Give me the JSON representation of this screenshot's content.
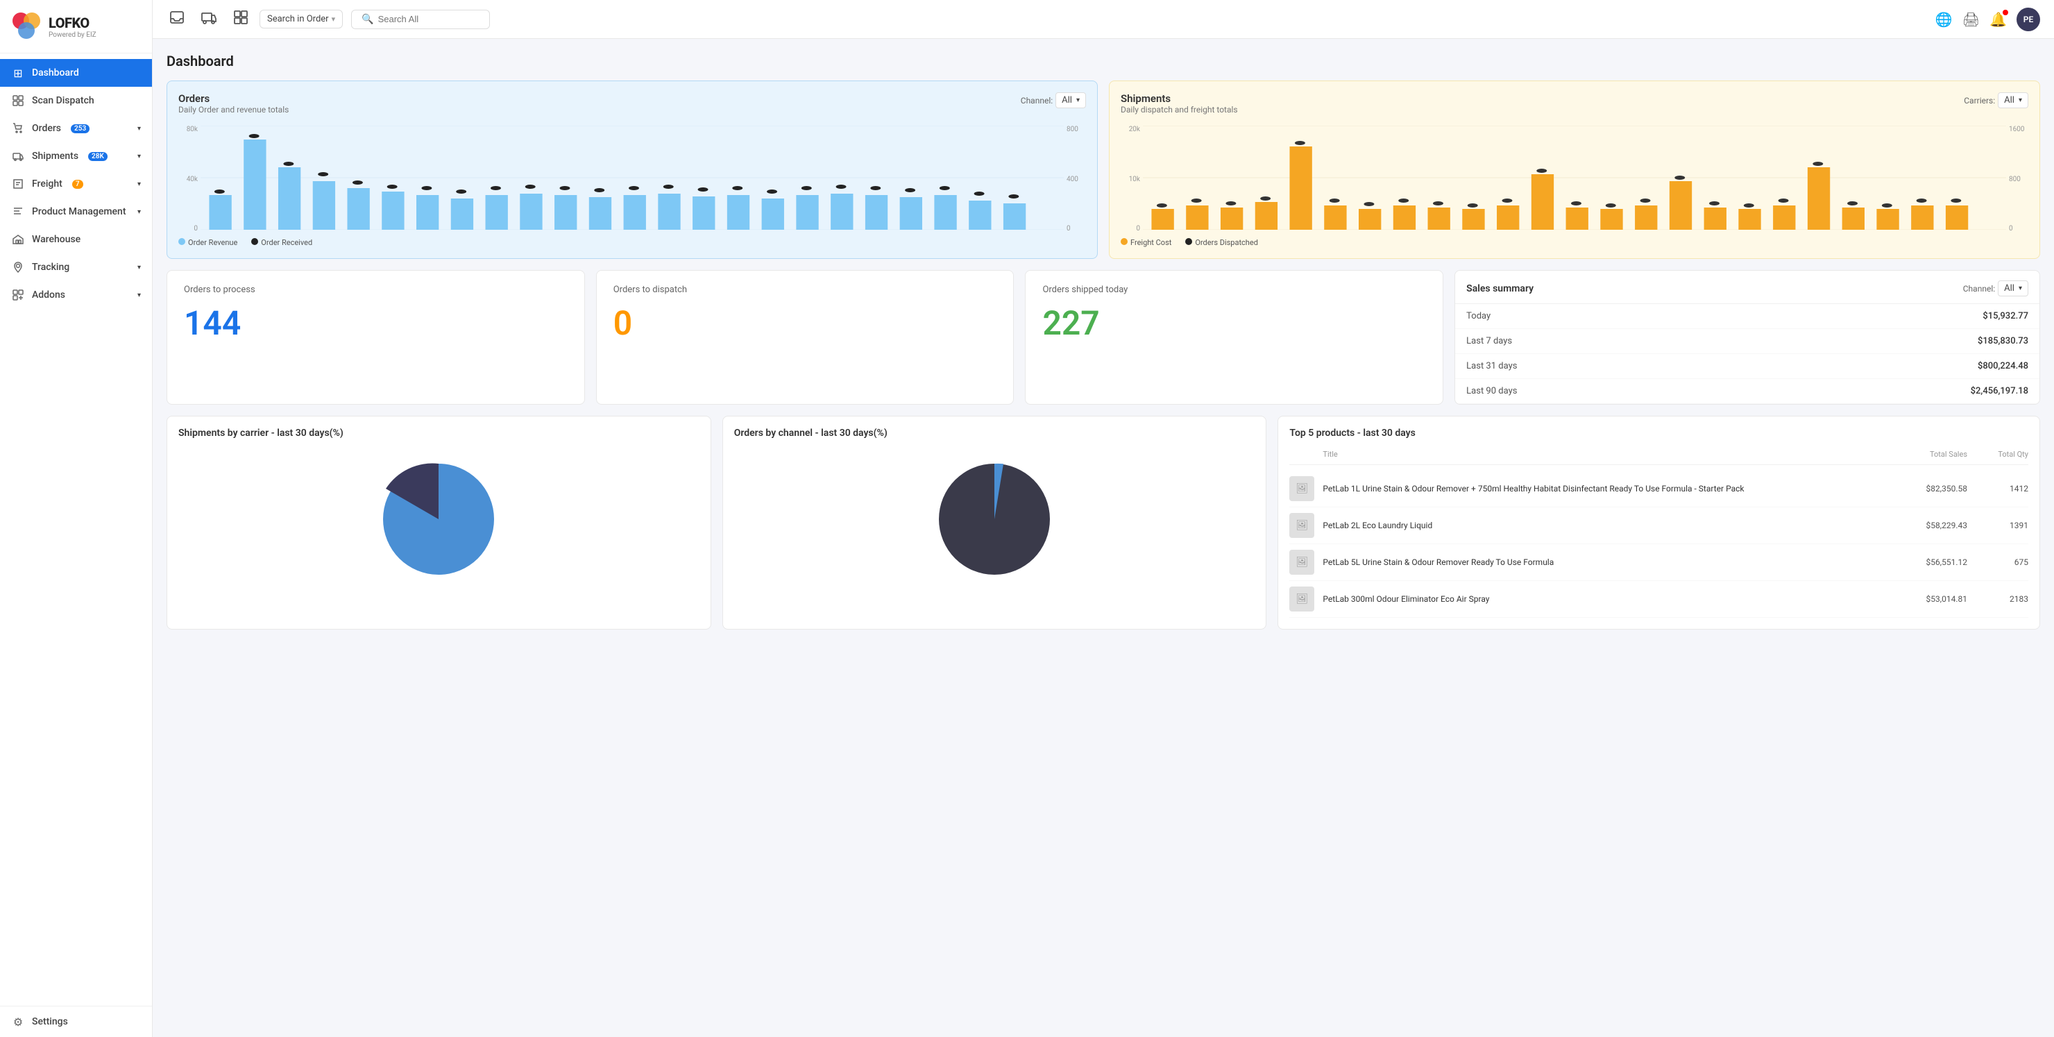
{
  "logo": {
    "main": "LOFKO",
    "sub": "Powered by EIZ"
  },
  "sidebar": {
    "items": [
      {
        "id": "dashboard",
        "label": "Dashboard",
        "icon": "⊞",
        "active": true
      },
      {
        "id": "scan-dispatch",
        "label": "Scan Dispatch",
        "icon": "📦"
      },
      {
        "id": "orders",
        "label": "Orders",
        "icon": "🛒",
        "badge": "253",
        "hasChildren": true
      },
      {
        "id": "shipments",
        "label": "Shipments",
        "icon": "🚚",
        "badge": "28K",
        "hasChildren": true
      },
      {
        "id": "freight",
        "label": "Freight",
        "icon": "📄",
        "badge": "7",
        "hasChildren": true
      },
      {
        "id": "product-management",
        "label": "Product Management",
        "icon": "📋",
        "hasChildren": true
      },
      {
        "id": "warehouse",
        "label": "Warehouse",
        "icon": "🏭"
      },
      {
        "id": "tracking",
        "label": "Tracking",
        "icon": "📍",
        "hasChildren": true
      },
      {
        "id": "addons",
        "label": "Addons",
        "icon": "🔌",
        "hasChildren": true
      }
    ],
    "settings": {
      "label": "Settings",
      "icon": "⚙"
    }
  },
  "topbar": {
    "search_order_placeholder": "Search in Order",
    "search_all_placeholder": "Search All"
  },
  "dashboard": {
    "title": "Dashboard",
    "orders_chart": {
      "title": "Orders",
      "subtitle": "Daily Order and revenue totals",
      "channel_label": "Channel:",
      "channel_value": "All",
      "y_left_label": "Order Received",
      "y_right_label": "Order Revenue",
      "y_left_max": "80k",
      "y_left_mid": "40k",
      "y_left_zero": "0",
      "y_right_max": "800",
      "y_right_mid": "400",
      "y_right_zero": "0",
      "legend": [
        {
          "label": "Order Revenue",
          "color": "#7ec8f5"
        },
        {
          "label": "Order Received",
          "color": "#222"
        }
      ]
    },
    "shipments_chart": {
      "title": "Shipments",
      "subtitle": "Daily dispatch and freight totals",
      "carriers_label": "Carriers:",
      "carriers_value": "All",
      "y_left_max": "20k",
      "y_left_mid": "10k",
      "y_left_zero": "0",
      "y_right_max": "1600",
      "y_right_mid": "800",
      "y_right_zero": "0",
      "y_left_label": "Orders Dispatched",
      "y_right_label": "Freight Cost",
      "legend": [
        {
          "label": "Freight Cost",
          "color": "#f5a623"
        },
        {
          "label": "Orders Dispatched",
          "color": "#222"
        }
      ]
    },
    "stats": {
      "orders_to_process": {
        "label": "Orders to process",
        "value": "144",
        "color": "blue"
      },
      "orders_to_dispatch": {
        "label": "Orders to dispatch",
        "value": "0",
        "color": "orange"
      },
      "orders_shipped_today": {
        "label": "Orders shipped today",
        "value": "227",
        "color": "green"
      }
    },
    "sales_summary": {
      "title": "Sales summary",
      "channel_label": "Channel:",
      "channel_value": "All",
      "rows": [
        {
          "period": "Today",
          "amount": "$15,932.77"
        },
        {
          "period": "Last 7 days",
          "amount": "$185,830.73"
        },
        {
          "period": "Last 31 days",
          "amount": "$800,224.48"
        },
        {
          "period": "Last 90 days",
          "amount": "$2,456,197.18"
        }
      ]
    },
    "shipments_by_carrier": {
      "title": "Shipments by carrier - last 30 days(%)"
    },
    "orders_by_channel": {
      "title": "Orders by channel - last 30 days(%)"
    },
    "top5_products": {
      "title": "Top 5 products - last 30 days",
      "col_title": "Title",
      "col_sales": "Total Sales",
      "col_qty": "Total Qty",
      "products": [
        {
          "name": "PetLab 1L Urine Stain & Odour Remover + 750ml Healthy Habitat Disinfectant Ready To Use Formula - Starter Pack",
          "sales": "$82,350.58",
          "qty": "1412"
        },
        {
          "name": "PetLab 2L Eco Laundry Liquid",
          "sales": "$58,229.43",
          "qty": "1391"
        },
        {
          "name": "PetLab 5L Urine Stain & Odour Remover Ready To Use Formula",
          "sales": "$56,551.12",
          "qty": "675"
        },
        {
          "name": "PetLab 300ml Odour Eliminator Eco Air Spray",
          "sales": "$53,014.81",
          "qty": "2183"
        }
      ]
    }
  }
}
